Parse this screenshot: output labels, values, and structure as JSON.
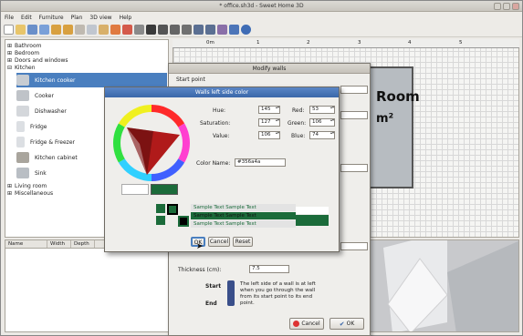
{
  "window": {
    "title": "* office.sh3d - Sweet Home 3D"
  },
  "menu": [
    "File",
    "Edit",
    "Furniture",
    "Plan",
    "3D view",
    "Help"
  ],
  "catalog": {
    "categories_top": [
      "Bathroom",
      "Bedroom",
      "Doors and windows",
      "Kitchen"
    ],
    "items": [
      "Kitchen cooker",
      "Cooker",
      "Dishwasher",
      "Fridge",
      "Fridge & Freezer",
      "Kitchen cabinet",
      "Sink"
    ],
    "categories_bottom": [
      "Living room",
      "Miscellaneous"
    ]
  },
  "furniture_columns": [
    "Name",
    "Width",
    "Depth"
  ],
  "ruler": {
    "labels": [
      "0m",
      "1",
      "2",
      "3",
      "4",
      "5"
    ]
  },
  "room": {
    "name": "Room",
    "area": "m²"
  },
  "walls_dialog": {
    "title": "Modify walls",
    "start_point_label": "Start point",
    "thickness_label": "Thickness (cm):",
    "thickness_value": "7.5",
    "start_label": "Start",
    "end_label": "End",
    "help_text": "The left side of a wall is at left when you go through the wall from its start point to its end point.",
    "cancel": "Cancel",
    "ok": "OK"
  },
  "color_dialog": {
    "title": "Walls left side color",
    "hue_label": "Hue:",
    "hue_value": "145",
    "saturation_label": "Saturation:",
    "saturation_value": "127",
    "value_label": "Value:",
    "value_value": "106",
    "red_label": "Red:",
    "red_value": "53",
    "green_label": "Green:",
    "green_value": "106",
    "blue_label": "Blue:",
    "blue_value": "74",
    "color_name_label": "Color Name:",
    "color_name_value": "#356a4a",
    "sample_text": "Sample Text  Sample Text",
    "ok": "OK",
    "cancel": "Cancel",
    "reset": "Reset",
    "current_color": "#356a4a",
    "previous_color": "#ffffff"
  }
}
